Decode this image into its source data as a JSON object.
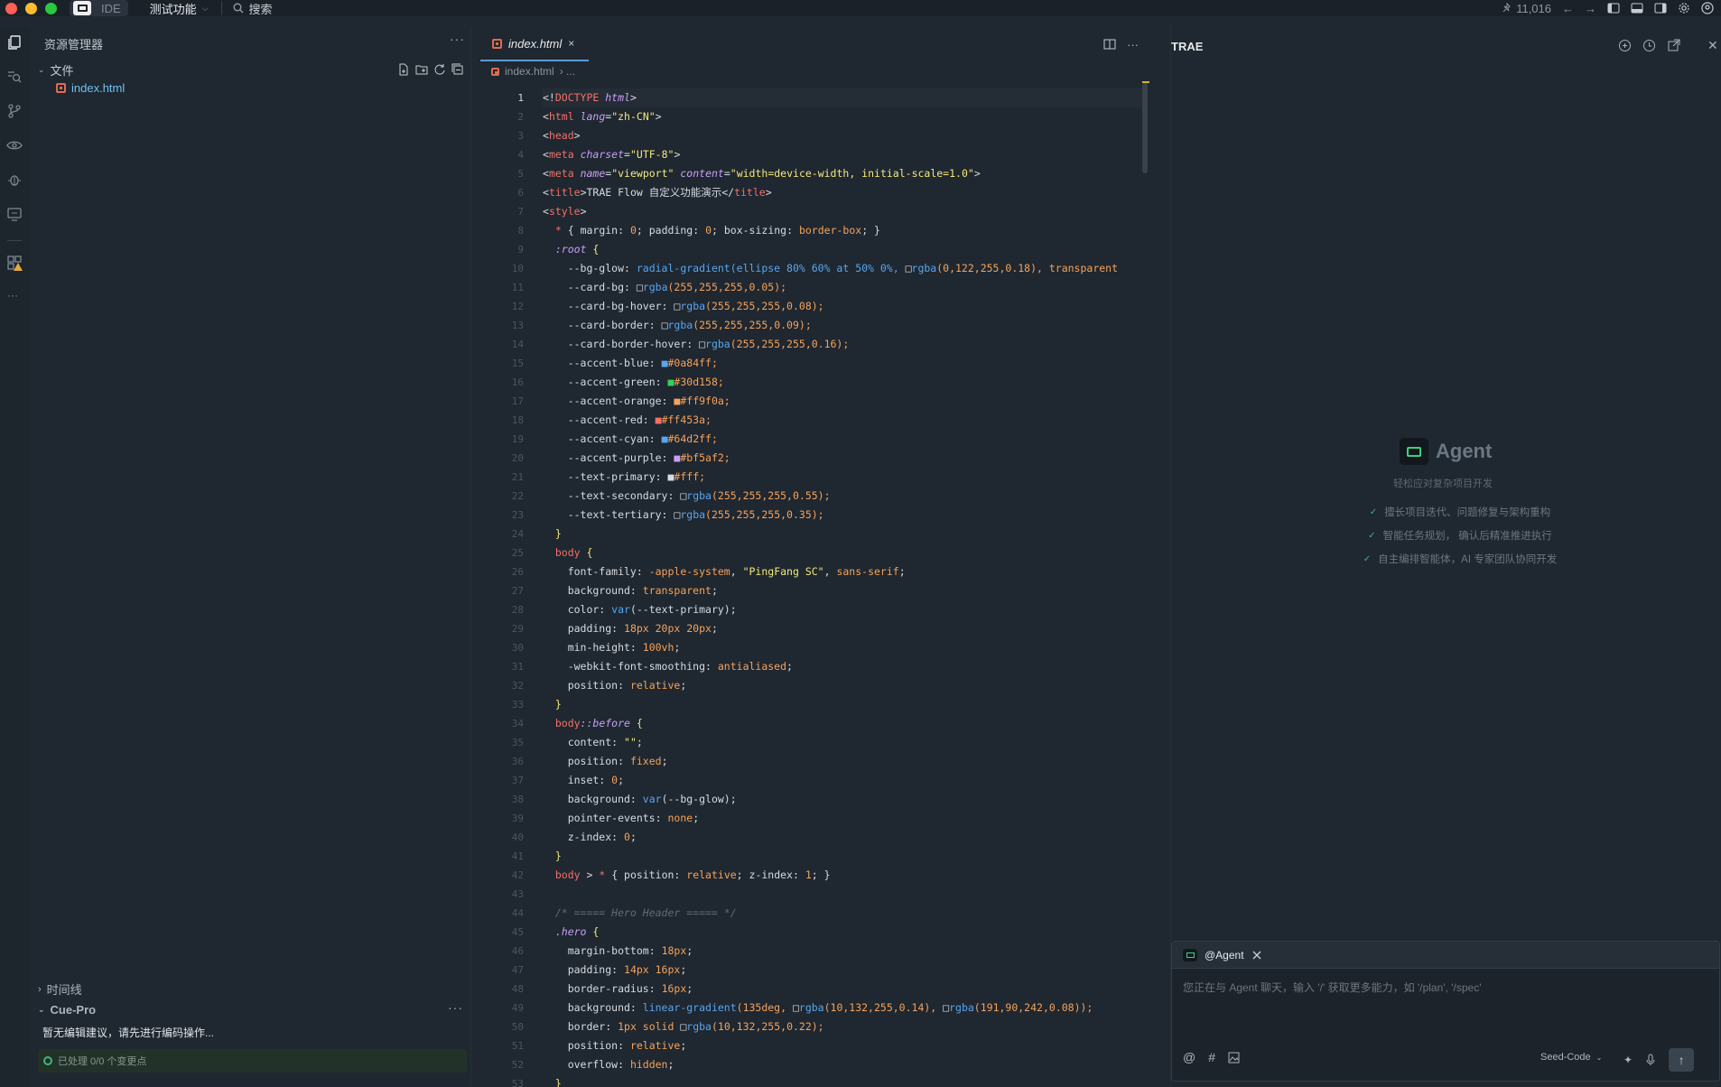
{
  "titlebar": {
    "app_badge": "IDE",
    "menu_feature": "测试功能",
    "search_label": "搜索",
    "stars": "11,016"
  },
  "colors": {
    "red": "#ff5f57",
    "yellow": "#febc2e",
    "green": "#28c840",
    "keyword": "#f47067",
    "string": "#f3e97a",
    "number": "#f5a35b",
    "func": "#58a6f0",
    "attr": "#c6a0f6",
    "comment": "#5f6b77"
  },
  "explorer": {
    "header": "资源管理器",
    "folder_label": "文件",
    "file_name": "index.html",
    "timeline_label": "时间线",
    "cuepro_label": "Cue-Pro",
    "cuepro_message": "暂无编辑建议，请先进行编码操作...",
    "status_text": "已处理 0/0 个变更点"
  },
  "editor": {
    "tab_label": "index.html",
    "tab_close": "×",
    "breadcrumb_file": "index.html",
    "breadcrumb_more": "› ..."
  },
  "agent": {
    "panel_title": "TRAE",
    "hero_name": "Agent",
    "hero_subtitle": "轻松应对复杂项目开发",
    "features": [
      "擅长项目迭代、问题修复与架构重构",
      "智能任务规划， 确认后精准推进执行",
      "自主编排智能体，AI 专家团队协同开发"
    ],
    "chat_mention": "@Agent",
    "chat_placeholder": "您正在与 Agent 聊天，输入 '/' 获取更多能力，如 '/plan', '/spec'",
    "model_name": "Seed-Code"
  },
  "code_lines": [
    [
      {
        "t": "<!",
        "c": "p"
      },
      {
        "t": "DOCTYPE",
        "c": "k"
      },
      {
        "t": " html",
        "c": "a"
      },
      {
        "t": ">",
        "c": "p"
      }
    ],
    [
      {
        "t": "<",
        "c": "p"
      },
      {
        "t": "html",
        "c": "k"
      },
      {
        "t": " lang",
        "c": "a"
      },
      {
        "t": "=",
        "c": "p"
      },
      {
        "t": "\"zh-CN\"",
        "c": "s"
      },
      {
        "t": ">",
        "c": "p"
      }
    ],
    [
      {
        "t": "<",
        "c": "p"
      },
      {
        "t": "head",
        "c": "k"
      },
      {
        "t": ">",
        "c": "p"
      }
    ],
    [
      {
        "t": "<",
        "c": "p"
      },
      {
        "t": "meta",
        "c": "k"
      },
      {
        "t": " charset",
        "c": "a"
      },
      {
        "t": "=",
        "c": "p"
      },
      {
        "t": "\"UTF-8\"",
        "c": "s"
      },
      {
        "t": ">",
        "c": "p"
      }
    ],
    [
      {
        "t": "<",
        "c": "p"
      },
      {
        "t": "meta",
        "c": "k"
      },
      {
        "t": " name",
        "c": "a"
      },
      {
        "t": "=",
        "c": "p"
      },
      {
        "t": "\"viewport\"",
        "c": "s"
      },
      {
        "t": " content",
        "c": "a"
      },
      {
        "t": "=",
        "c": "p"
      },
      {
        "t": "\"width=device-width, initial-scale=1.0\"",
        "c": "s"
      },
      {
        "t": ">",
        "c": "p"
      }
    ],
    [
      {
        "t": "<",
        "c": "p"
      },
      {
        "t": "title",
        "c": "k"
      },
      {
        "t": ">TRAE Flow 自定义功能演示</",
        "c": "p"
      },
      {
        "t": "title",
        "c": "k"
      },
      {
        "t": ">",
        "c": "p"
      }
    ],
    [
      {
        "t": "<",
        "c": "p"
      },
      {
        "t": "style",
        "c": "k"
      },
      {
        "t": ">",
        "c": "p"
      }
    ],
    [
      {
        "t": "  ",
        "c": "p"
      },
      {
        "t": "*",
        "c": "k"
      },
      {
        "t": " { margin: ",
        "c": "p"
      },
      {
        "t": "0",
        "c": "n"
      },
      {
        "t": "; padding: ",
        "c": "p"
      },
      {
        "t": "0",
        "c": "n"
      },
      {
        "t": "; box-sizing: ",
        "c": "p"
      },
      {
        "t": "border-box",
        "c": "n"
      },
      {
        "t": "; }",
        "c": "p"
      }
    ],
    [
      {
        "t": "  ",
        "c": "p"
      },
      {
        "t": ":root",
        "c": "a"
      },
      {
        "t": " {",
        "c": "s"
      }
    ],
    [
      {
        "t": "    --bg-glow: ",
        "c": "p"
      },
      {
        "t": "radial-gradient",
        "c": "f"
      },
      {
        "t": "(ellipse 80% 60% at 50% 0%, ",
        "c": "f"
      },
      {
        "t": "□",
        "c": "p"
      },
      {
        "t": "rgba",
        "c": "f"
      },
      {
        "t": "(0,122,255,0.18), transparent",
        "c": "n"
      }
    ],
    [
      {
        "t": "    --card-bg: ",
        "c": "p"
      },
      {
        "t": "□",
        "c": "p"
      },
      {
        "t": "rgba",
        "c": "f"
      },
      {
        "t": "(255,255,255,0.05);",
        "c": "n"
      }
    ],
    [
      {
        "t": "    --card-bg-hover: ",
        "c": "p"
      },
      {
        "t": "□",
        "c": "p"
      },
      {
        "t": "rgba",
        "c": "f"
      },
      {
        "t": "(255,255,255,0.08);",
        "c": "n"
      }
    ],
    [
      {
        "t": "    --card-border: ",
        "c": "p"
      },
      {
        "t": "□",
        "c": "p"
      },
      {
        "t": "rgba",
        "c": "f"
      },
      {
        "t": "(255,255,255,0.09);",
        "c": "n"
      }
    ],
    [
      {
        "t": "    --card-border-hover: ",
        "c": "p"
      },
      {
        "t": "□",
        "c": "p"
      },
      {
        "t": "rgba",
        "c": "f"
      },
      {
        "t": "(255,255,255,0.16);",
        "c": "n"
      }
    ],
    [
      {
        "t": "    --accent-blue: ",
        "c": "p"
      },
      {
        "t": "■",
        "c": "f"
      },
      {
        "t": "#0a84ff;",
        "c": "n"
      }
    ],
    [
      {
        "t": "    --accent-green: ",
        "c": "p"
      },
      {
        "t": "■",
        "c": "g"
      },
      {
        "t": "#30d158;",
        "c": "n"
      }
    ],
    [
      {
        "t": "    --accent-orange: ",
        "c": "p"
      },
      {
        "t": "■",
        "c": "n"
      },
      {
        "t": "#ff9f0a;",
        "c": "n"
      }
    ],
    [
      {
        "t": "    --accent-red: ",
        "c": "p"
      },
      {
        "t": "■",
        "c": "k"
      },
      {
        "t": "#ff453a;",
        "c": "n"
      }
    ],
    [
      {
        "t": "    --accent-cyan: ",
        "c": "p"
      },
      {
        "t": "■",
        "c": "f"
      },
      {
        "t": "#64d2ff;",
        "c": "n"
      }
    ],
    [
      {
        "t": "    --accent-purple: ",
        "c": "p"
      },
      {
        "t": "■",
        "c": "a"
      },
      {
        "t": "#bf5af2;",
        "c": "n"
      }
    ],
    [
      {
        "t": "    --text-primary: ",
        "c": "p"
      },
      {
        "t": "■",
        "c": "p"
      },
      {
        "t": "#fff;",
        "c": "n"
      }
    ],
    [
      {
        "t": "    --text-secondary: ",
        "c": "p"
      },
      {
        "t": "□",
        "c": "p"
      },
      {
        "t": "rgba",
        "c": "f"
      },
      {
        "t": "(255,255,255,0.55);",
        "c": "n"
      }
    ],
    [
      {
        "t": "    --text-tertiary: ",
        "c": "p"
      },
      {
        "t": "□",
        "c": "p"
      },
      {
        "t": "rgba",
        "c": "f"
      },
      {
        "t": "(255,255,255,0.35);",
        "c": "n"
      }
    ],
    [
      {
        "t": "  }",
        "c": "s"
      }
    ],
    [
      {
        "t": "  body",
        "c": "k"
      },
      {
        "t": " {",
        "c": "s"
      }
    ],
    [
      {
        "t": "    font-family: ",
        "c": "p"
      },
      {
        "t": "-apple-system",
        "c": "n"
      },
      {
        "t": ", ",
        "c": "p"
      },
      {
        "t": "\"PingFang SC\"",
        "c": "s"
      },
      {
        "t": ", ",
        "c": "p"
      },
      {
        "t": "sans-serif",
        "c": "n"
      },
      {
        "t": ";",
        "c": "p"
      }
    ],
    [
      {
        "t": "    background: ",
        "c": "p"
      },
      {
        "t": "transparent",
        "c": "n"
      },
      {
        "t": ";",
        "c": "p"
      }
    ],
    [
      {
        "t": "    color: ",
        "c": "p"
      },
      {
        "t": "var",
        "c": "f"
      },
      {
        "t": "(--text-primary);",
        "c": "p"
      }
    ],
    [
      {
        "t": "    padding: ",
        "c": "p"
      },
      {
        "t": "18px 20px 20px",
        "c": "n"
      },
      {
        "t": ";",
        "c": "p"
      }
    ],
    [
      {
        "t": "    min-height: ",
        "c": "p"
      },
      {
        "t": "100vh",
        "c": "n"
      },
      {
        "t": ";",
        "c": "p"
      }
    ],
    [
      {
        "t": "    -webkit-font-smoothing: ",
        "c": "p"
      },
      {
        "t": "antialiased",
        "c": "n"
      },
      {
        "t": ";",
        "c": "p"
      }
    ],
    [
      {
        "t": "    position: ",
        "c": "p"
      },
      {
        "t": "relative",
        "c": "n"
      },
      {
        "t": ";",
        "c": "p"
      }
    ],
    [
      {
        "t": "  }",
        "c": "s"
      }
    ],
    [
      {
        "t": "  body",
        "c": "k"
      },
      {
        "t": "::before",
        "c": "a"
      },
      {
        "t": " {",
        "c": "s"
      }
    ],
    [
      {
        "t": "    content: ",
        "c": "p"
      },
      {
        "t": "\"\"",
        "c": "s"
      },
      {
        "t": ";",
        "c": "p"
      }
    ],
    [
      {
        "t": "    position: ",
        "c": "p"
      },
      {
        "t": "fixed",
        "c": "n"
      },
      {
        "t": ";",
        "c": "p"
      }
    ],
    [
      {
        "t": "    inset: ",
        "c": "p"
      },
      {
        "t": "0",
        "c": "n"
      },
      {
        "t": ";",
        "c": "p"
      }
    ],
    [
      {
        "t": "    background: ",
        "c": "p"
      },
      {
        "t": "var",
        "c": "f"
      },
      {
        "t": "(--bg-glow);",
        "c": "p"
      }
    ],
    [
      {
        "t": "    pointer-events: ",
        "c": "p"
      },
      {
        "t": "none",
        "c": "n"
      },
      {
        "t": ";",
        "c": "p"
      }
    ],
    [
      {
        "t": "    z-index: ",
        "c": "p"
      },
      {
        "t": "0",
        "c": "n"
      },
      {
        "t": ";",
        "c": "p"
      }
    ],
    [
      {
        "t": "  }",
        "c": "s"
      }
    ],
    [
      {
        "t": "  body",
        "c": "k"
      },
      {
        "t": " > ",
        "c": "p"
      },
      {
        "t": "*",
        "c": "k"
      },
      {
        "t": " { position: ",
        "c": "p"
      },
      {
        "t": "relative",
        "c": "n"
      },
      {
        "t": "; z-index: ",
        "c": "p"
      },
      {
        "t": "1",
        "c": "n"
      },
      {
        "t": "; }",
        "c": "p"
      }
    ],
    [
      {
        "t": "",
        "c": "p"
      }
    ],
    [
      {
        "t": "  /* ===== Hero Header ===== */",
        "c": "c"
      }
    ],
    [
      {
        "t": "  .hero",
        "c": "a"
      },
      {
        "t": " {",
        "c": "s"
      }
    ],
    [
      {
        "t": "    margin-bottom: ",
        "c": "p"
      },
      {
        "t": "18px",
        "c": "n"
      },
      {
        "t": ";",
        "c": "p"
      }
    ],
    [
      {
        "t": "    padding: ",
        "c": "p"
      },
      {
        "t": "14px 16px",
        "c": "n"
      },
      {
        "t": ";",
        "c": "p"
      }
    ],
    [
      {
        "t": "    border-radius: ",
        "c": "p"
      },
      {
        "t": "16px",
        "c": "n"
      },
      {
        "t": ";",
        "c": "p"
      }
    ],
    [
      {
        "t": "    background: ",
        "c": "p"
      },
      {
        "t": "linear-gradient",
        "c": "f"
      },
      {
        "t": "(135deg, ",
        "c": "n"
      },
      {
        "t": "□",
        "c": "p"
      },
      {
        "t": "rgba",
        "c": "f"
      },
      {
        "t": "(10,132,255,0.14), ",
        "c": "n"
      },
      {
        "t": "□",
        "c": "p"
      },
      {
        "t": "rgba",
        "c": "f"
      },
      {
        "t": "(191,90,242,0.08));",
        "c": "n"
      }
    ],
    [
      {
        "t": "    border: ",
        "c": "p"
      },
      {
        "t": "1px solid ",
        "c": "n"
      },
      {
        "t": "□",
        "c": "p"
      },
      {
        "t": "rgba",
        "c": "f"
      },
      {
        "t": "(10,132,255,0.22);",
        "c": "n"
      }
    ],
    [
      {
        "t": "    position: ",
        "c": "p"
      },
      {
        "t": "relative",
        "c": "n"
      },
      {
        "t": ";",
        "c": "p"
      }
    ],
    [
      {
        "t": "    overflow: ",
        "c": "p"
      },
      {
        "t": "hidden",
        "c": "n"
      },
      {
        "t": ";",
        "c": "p"
      }
    ],
    [
      {
        "t": "  }",
        "c": "s"
      }
    ]
  ]
}
